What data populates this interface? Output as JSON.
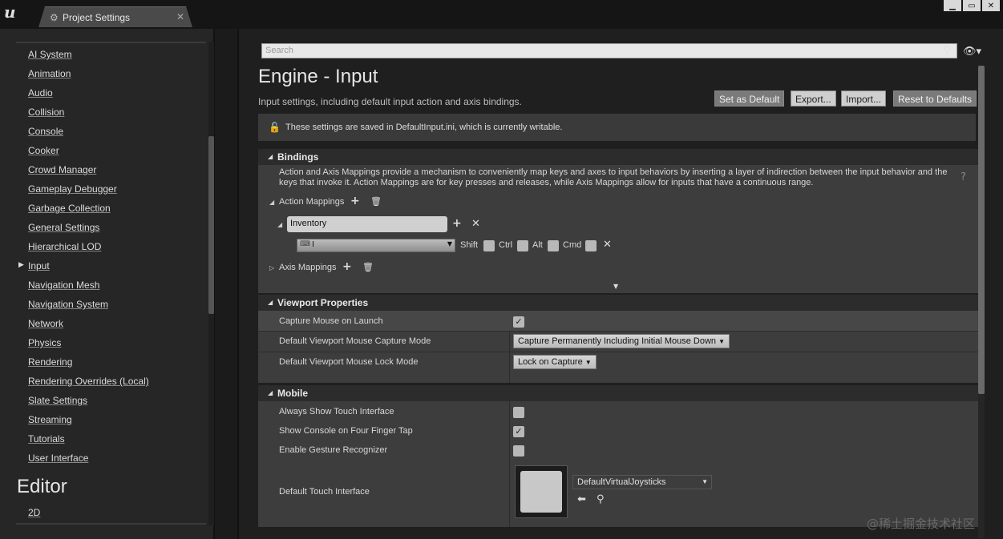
{
  "window": {
    "tab_title": "Project Settings",
    "close_glyph": "✕",
    "controls": [
      "▁",
      "▭",
      "✕"
    ]
  },
  "sidebar": {
    "items": [
      {
        "label": "AI System"
      },
      {
        "label": "Animation"
      },
      {
        "label": "Audio"
      },
      {
        "label": "Collision"
      },
      {
        "label": "Console"
      },
      {
        "label": "Cooker"
      },
      {
        "label": "Crowd Manager"
      },
      {
        "label": "Gameplay Debugger"
      },
      {
        "label": "Garbage Collection"
      },
      {
        "label": "General Settings"
      },
      {
        "label": "Hierarchical LOD"
      },
      {
        "label": "Input"
      },
      {
        "label": "Navigation Mesh"
      },
      {
        "label": "Navigation System"
      },
      {
        "label": "Network"
      },
      {
        "label": "Physics"
      },
      {
        "label": "Rendering"
      },
      {
        "label": "Rendering Overrides (Local)"
      },
      {
        "label": "Slate Settings"
      },
      {
        "label": "Streaming"
      },
      {
        "label": "Tutorials"
      },
      {
        "label": "User Interface"
      }
    ],
    "selected": "Input",
    "section_title": "Editor",
    "section_items": [
      "2D"
    ]
  },
  "search": {
    "placeholder": "Search"
  },
  "header": {
    "title": "Engine - Input",
    "description": "Input settings, including default input action and axis bindings.",
    "buttons": {
      "set_default": "Set as Default",
      "export": "Export...",
      "import": "Import...",
      "reset": "Reset to Defaults"
    }
  },
  "notice": {
    "text": "These settings are saved in DefaultInput.ini, which is currently writable."
  },
  "bindings": {
    "title": "Bindings",
    "help": "Action and Axis Mappings provide a mechanism to conveniently map keys and axes to input behaviors by inserting a layer of indirection between the input behavior and the keys that invoke it. Action Mappings are for key presses and releases, while Axis Mappings allow for inputs that have a continuous range.",
    "action_mappings_label": "Action Mappings",
    "action_name": "Inventory",
    "key_value": "I",
    "modifiers": [
      "Shift",
      "Ctrl",
      "Alt",
      "Cmd"
    ],
    "axis_mappings_label": "Axis Mappings"
  },
  "viewport": {
    "title": "Viewport Properties",
    "rows": [
      {
        "label": "Capture Mouse on Launch",
        "checked": true
      },
      {
        "label": "Default Viewport Mouse Capture Mode",
        "value": "Capture Permanently Including Initial Mouse Down"
      },
      {
        "label": "Default Viewport Mouse Lock Mode",
        "value": "Lock on Capture"
      }
    ]
  },
  "mobile": {
    "title": "Mobile",
    "rows": [
      {
        "label": "Always Show Touch Interface",
        "checked": false
      },
      {
        "label": "Show Console on Four Finger Tap",
        "checked": true
      },
      {
        "label": "Enable Gesture Recognizer",
        "checked": false
      },
      {
        "label": "Default Touch Interface",
        "value": "DefaultVirtualJoysticks"
      }
    ]
  },
  "watermark": "@稀土掘金技术社区"
}
